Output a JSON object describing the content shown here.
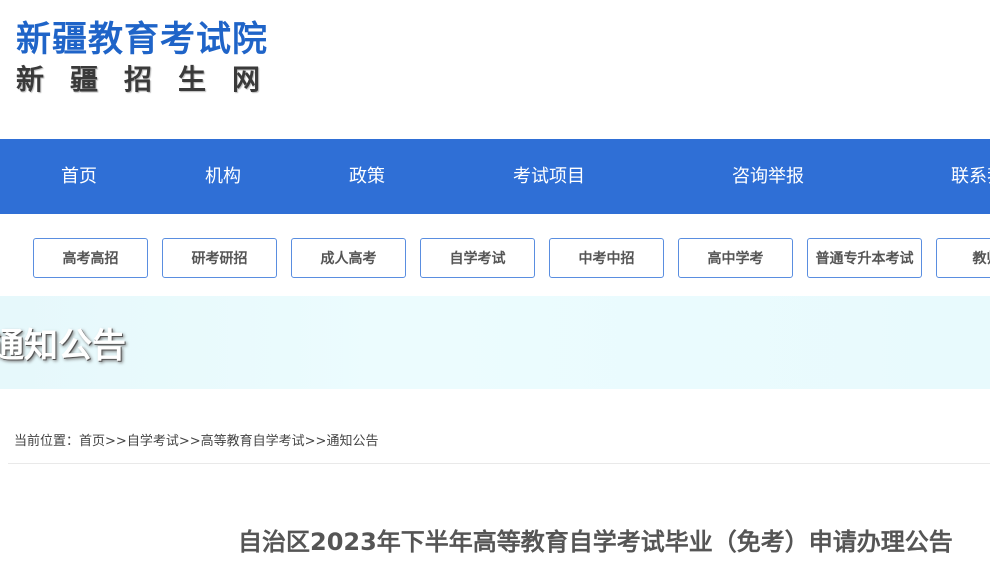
{
  "header": {
    "logo_main": "新疆教育考试院",
    "logo_sub": "新疆招生网"
  },
  "main_nav": [
    {
      "label": "首页"
    },
    {
      "label": "机构"
    },
    {
      "label": "政策"
    },
    {
      "label": "考试项目"
    },
    {
      "label": "咨询举报"
    },
    {
      "label": "联系我"
    }
  ],
  "sub_nav": [
    {
      "label": "高考高招"
    },
    {
      "label": "研考研招"
    },
    {
      "label": "成人高考"
    },
    {
      "label": "自学考试"
    },
    {
      "label": "中考中招"
    },
    {
      "label": "高中学考"
    },
    {
      "label": "普通专升本考试"
    },
    {
      "label": "教师资"
    }
  ],
  "banner": {
    "title": "通知公告"
  },
  "breadcrumb": {
    "prefix": "当前位置：",
    "items": [
      {
        "label": "首页"
      },
      {
        "label": "自学考试"
      },
      {
        "label": "高等教育自学考试"
      },
      {
        "label": "通知公告"
      }
    ],
    "separator": ">>"
  },
  "article": {
    "title": "自治区2023年下半年高等教育自学考试毕业（免考）申请办理公告"
  },
  "colors": {
    "brand_blue": "#2f6fd6",
    "logo_blue": "#1f64c8",
    "banner_bg": "#e8fafd"
  }
}
